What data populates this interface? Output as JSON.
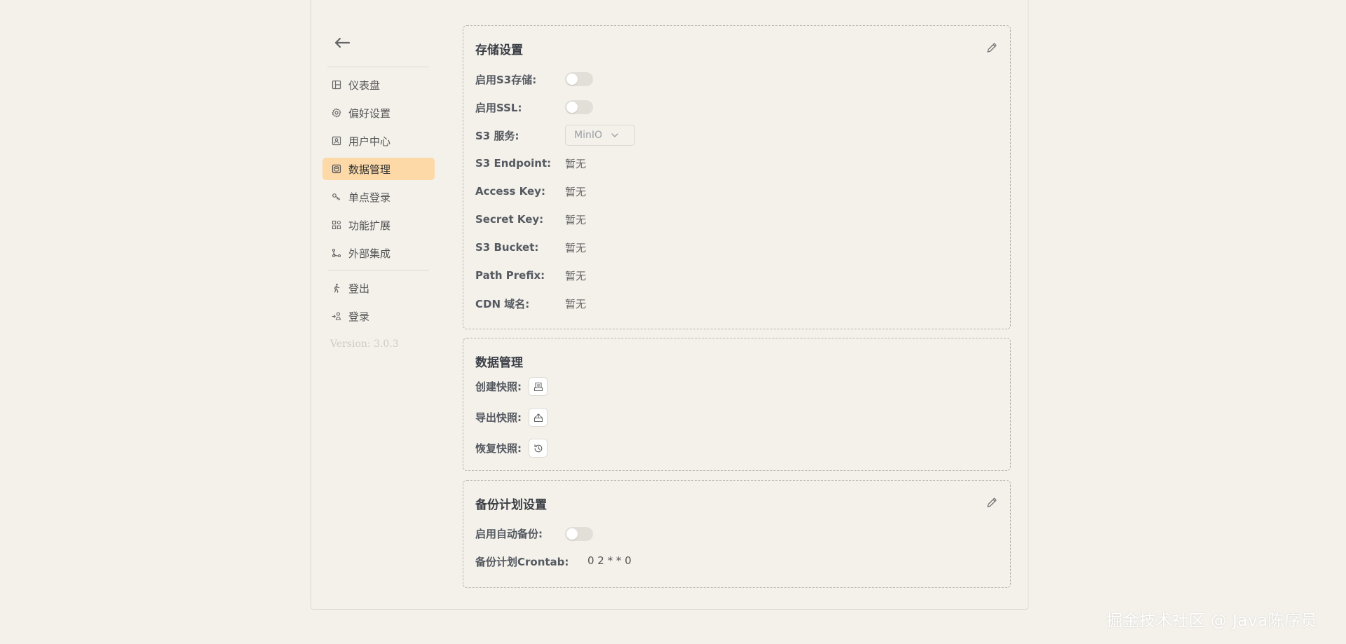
{
  "sidebar": {
    "items": [
      {
        "label": "仪表盘",
        "icon": "dashboard-icon"
      },
      {
        "label": "偏好设置",
        "icon": "gear-icon"
      },
      {
        "label": "用户中心",
        "icon": "user-center-icon"
      },
      {
        "label": "数据管理",
        "icon": "database-icon",
        "active": true
      },
      {
        "label": "单点登录",
        "icon": "key-icon"
      },
      {
        "label": "功能扩展",
        "icon": "apps-icon"
      },
      {
        "label": "外部集成",
        "icon": "integration-icon"
      }
    ],
    "account_items": [
      {
        "label": "登出",
        "icon": "walk-icon"
      },
      {
        "label": "登录",
        "icon": "login-icon"
      }
    ],
    "version": "Version: 3.0.3"
  },
  "storage": {
    "title": "存储设置",
    "enable_s3_label": "启用S3存储:",
    "enable_s3": false,
    "enable_ssl_label": "启用SSL:",
    "enable_ssl": false,
    "s3_service_label": "S3 服务:",
    "s3_service_value": "MinIO",
    "endpoint_label": "S3 Endpoint:",
    "endpoint_value": "暂无",
    "access_key_label": "Access Key:",
    "access_key_value": "暂无",
    "secret_key_label": "Secret Key:",
    "secret_key_value": "暂无",
    "bucket_label": "S3 Bucket:",
    "bucket_value": "暂无",
    "prefix_label": "Path Prefix:",
    "prefix_value": "暂无",
    "cdn_label": "CDN 域名:",
    "cdn_value": "暂无"
  },
  "data_mgmt": {
    "title": "数据管理",
    "create_label": "创建快照:",
    "export_label": "导出快照:",
    "restore_label": "恢复快照:"
  },
  "backup": {
    "title": "备份计划设置",
    "auto_label": "启用自动备份:",
    "auto_enabled": false,
    "crontab_label": "备份计划Crontab:",
    "crontab_value": "0 2 * * 0"
  },
  "watermark": "掘金技术社区 @ Java陈序员",
  "colors": {
    "background": "#f4f1eb",
    "active_nav": "#fcd9a7",
    "toggle_off": "#e2dfd8",
    "card_border": "#b9b5ad"
  }
}
